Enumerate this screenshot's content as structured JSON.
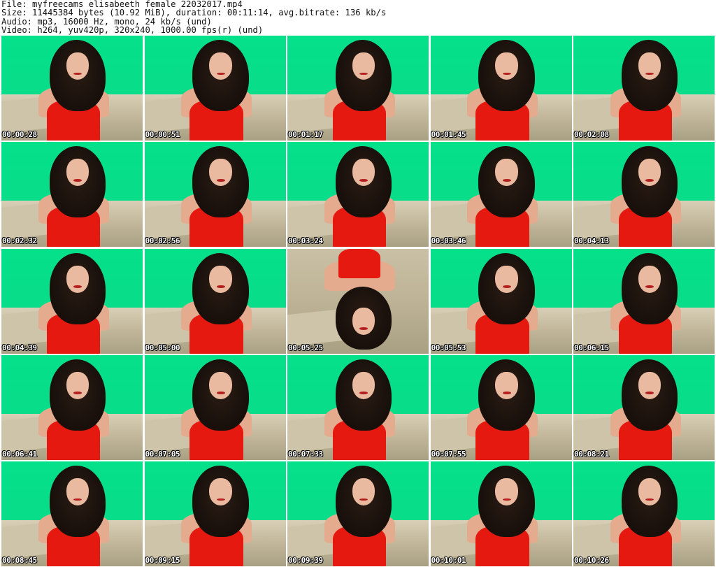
{
  "header": {
    "file_line": "File: myfreecams_elisabeeth_female_22032017.mp4",
    "size_line": "Size: 11445384 bytes (10.92 MiB), duration: 00:11:14, avg.bitrate: 136 kb/s",
    "audio_line": "Audio: mp3, 16000 Hz, mono, 24 kb/s (und)",
    "video_line": "Video: h264, yuv420p, 320x240, 1000.00 fps(r) (und)"
  },
  "colors": {
    "background": "#ffffff",
    "green_screen": "#05e08a",
    "dress_red": "#e5190f",
    "timestamp_text": "#ffffff"
  },
  "thumbnails": [
    {
      "timestamp": "00:00:28"
    },
    {
      "timestamp": "00:00:51"
    },
    {
      "timestamp": "00:01:17"
    },
    {
      "timestamp": "00:01:45"
    },
    {
      "timestamp": "00:02:08"
    },
    {
      "timestamp": "00:02:32"
    },
    {
      "timestamp": "00:02:56"
    },
    {
      "timestamp": "00:03:24"
    },
    {
      "timestamp": "00:03:46"
    },
    {
      "timestamp": "00:04:13"
    },
    {
      "timestamp": "00:04:39"
    },
    {
      "timestamp": "00:05:00"
    },
    {
      "timestamp": "00:05:25",
      "inverted": true
    },
    {
      "timestamp": "00:05:53"
    },
    {
      "timestamp": "00:06:15"
    },
    {
      "timestamp": "00:06:41"
    },
    {
      "timestamp": "00:07:05"
    },
    {
      "timestamp": "00:07:33"
    },
    {
      "timestamp": "00:07:55"
    },
    {
      "timestamp": "00:08:21"
    },
    {
      "timestamp": "00:08:45"
    },
    {
      "timestamp": "00:09:15"
    },
    {
      "timestamp": "00:09:39"
    },
    {
      "timestamp": "00:10:01"
    },
    {
      "timestamp": "00:10:26"
    }
  ]
}
